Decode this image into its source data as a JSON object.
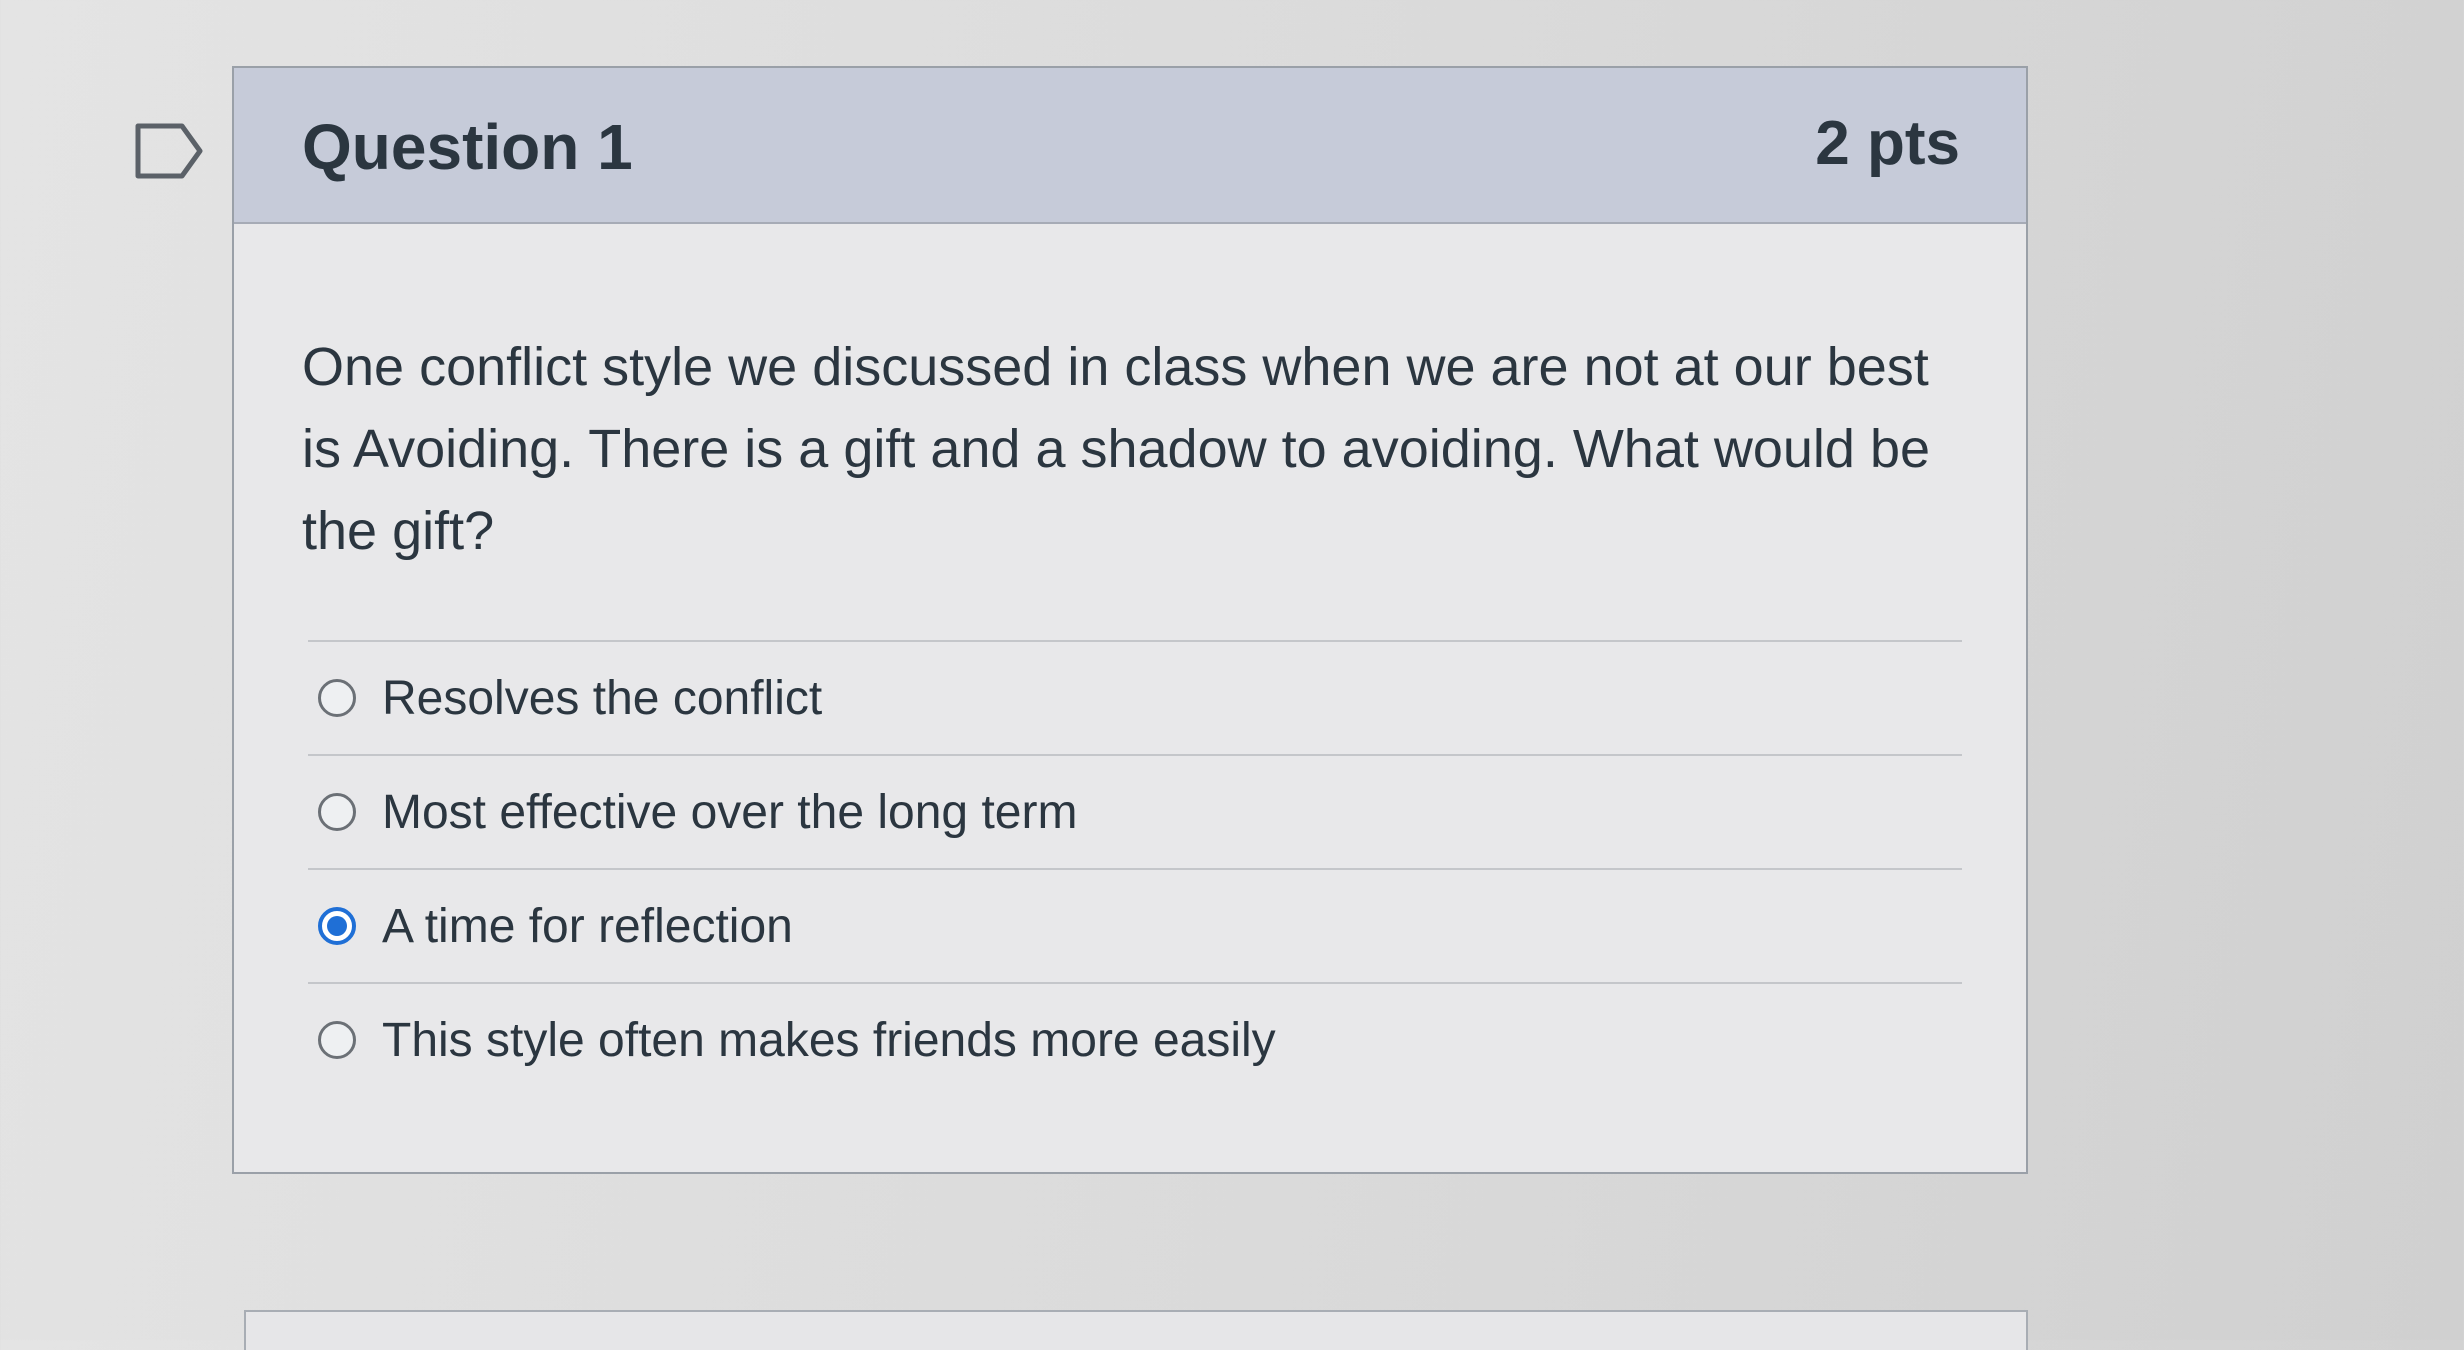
{
  "question": {
    "title": "Question 1",
    "points": "2 pts",
    "prompt": "One conflict style we discussed in class when we are not at our best is Avoiding. There is a gift and a shadow to avoiding. What would be the gift?"
  },
  "answers": [
    {
      "label": "Resolves the conflict",
      "selected": false
    },
    {
      "label": "Most effective over the long term",
      "selected": false
    },
    {
      "label": "A time for reflection",
      "selected": true
    },
    {
      "label": "This style often makes friends more easily",
      "selected": false
    }
  ],
  "icons": {
    "flag": "flag-outline-icon"
  },
  "colors": {
    "header_background": "#c6cbd9",
    "selected_radio": "#1f6fd6"
  }
}
